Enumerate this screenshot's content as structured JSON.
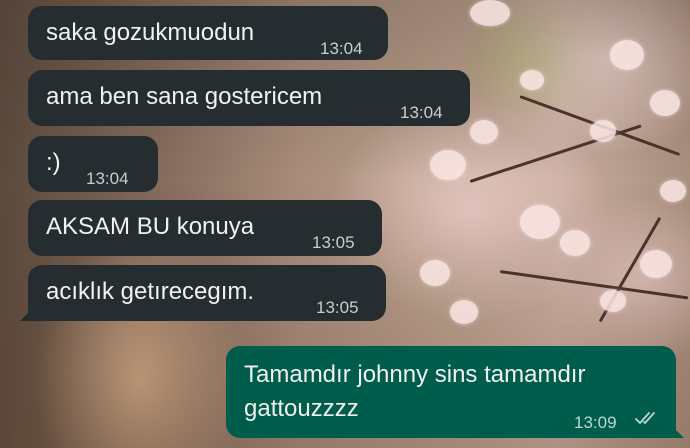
{
  "messages": [
    {
      "text": "saka gozukmuodun",
      "time": "13:04",
      "direction": "incoming"
    },
    {
      "text": "ama ben sana gostericem",
      "time": "13:04",
      "direction": "incoming"
    },
    {
      "text": ":)",
      "time": "13:04",
      "direction": "incoming"
    },
    {
      "text": "AKSAM BU konuya",
      "time": "13:05",
      "direction": "incoming"
    },
    {
      "text": "acıklık getırecegım.",
      "time": "13:05",
      "direction": "incoming"
    },
    {
      "text_line1": "Tamamdır johnny sins tamamdır",
      "text_line2": "gattouzzzz",
      "time": "13:09",
      "direction": "outgoing",
      "status_icon": "double-check-read-icon"
    }
  ],
  "colors": {
    "incoming_bubble": "#262d31",
    "outgoing_bubble": "#005c4b",
    "text": "#f1f1f1",
    "timestamp": "#c8cdd0"
  }
}
